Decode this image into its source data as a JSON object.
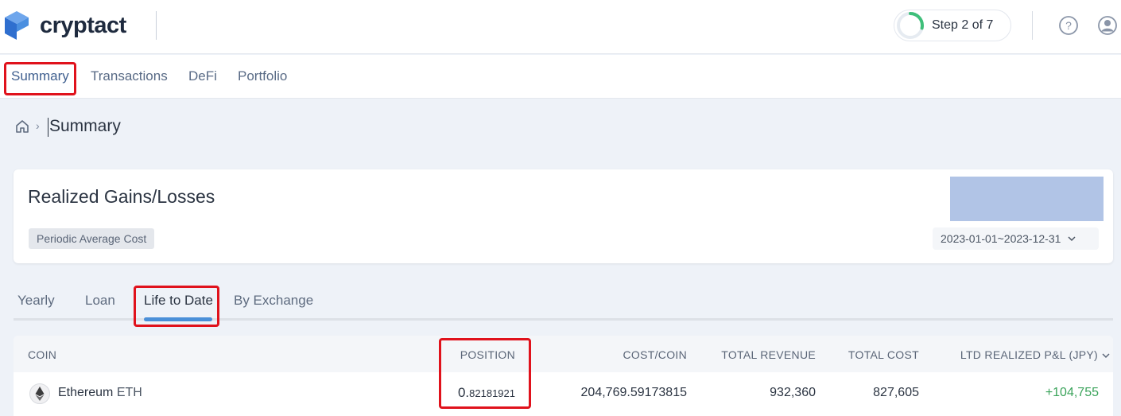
{
  "app": {
    "name": "cryptact"
  },
  "header": {
    "step_label": "Step 2 of 7",
    "step_progress": 0.2857
  },
  "nav": {
    "items": [
      {
        "label": "Summary"
      },
      {
        "label": "Transactions"
      },
      {
        "label": "DeFi"
      },
      {
        "label": "Portfolio"
      }
    ]
  },
  "breadcrumb": {
    "current": "Summary"
  },
  "card": {
    "title": "Realized Gains/Losses",
    "method_badge": "Periodic Average Cost",
    "date_range": "2023-01-01~2023-12-31",
    "swatch_color": "#b1c4e6"
  },
  "tabs": [
    {
      "label": "Yearly"
    },
    {
      "label": "Loan"
    },
    {
      "label": "Life to Date"
    },
    {
      "label": "By Exchange"
    }
  ],
  "table": {
    "columns": [
      "COIN",
      "POSITION",
      "COST/COIN",
      "TOTAL REVENUE",
      "TOTAL COST",
      "LTD REALIZED P&L (JPY)"
    ],
    "rows": [
      {
        "coin_name": "Ethereum",
        "coin_symbol": "ETH",
        "position_int": "0.",
        "position_dec": "82181921",
        "cost_per_coin": "204,769.59173815",
        "total_revenue": "932,360",
        "total_cost": "827,605",
        "ltd_pnl": "+104,755"
      }
    ]
  },
  "colors": {
    "accent": "#4a8fd8",
    "highlight": "#e0121c",
    "positive": "#3aa35a",
    "logo_blue": "#3b7dd8"
  }
}
